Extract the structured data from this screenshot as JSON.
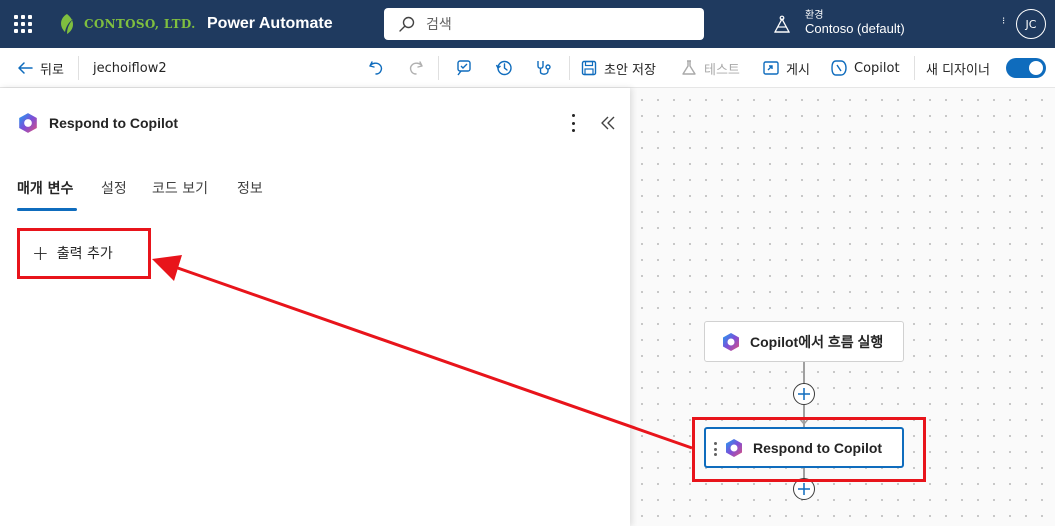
{
  "header": {
    "brand": "CONTOSO, LTD.",
    "app_title": "Power Automate",
    "search_placeholder": "검색",
    "environment_label": "환경",
    "environment_name": "Contoso (default)",
    "user_initials": "JC",
    "background_color": "#1f3a5f"
  },
  "toolbar": {
    "back_label": "뒤로",
    "flow_name": "jechoiflow2",
    "save_draft_label": "초안 저장",
    "test_label": "테스트",
    "publish_label": "게시",
    "copilot_label": "Copilot",
    "new_designer_label": "새 디자이너",
    "new_designer_on": true,
    "accent_color": "#0f6cbd"
  },
  "panel": {
    "title": "Respond to Copilot",
    "tabs": [
      {
        "label": "매개 변수",
        "active": true
      },
      {
        "label": "설정",
        "active": false
      },
      {
        "label": "코드 보기",
        "active": false
      },
      {
        "label": "정보",
        "active": false
      }
    ],
    "add_output_label": "출력 추가"
  },
  "canvas": {
    "nodes": [
      {
        "title": "Copilot에서 흐름 실행",
        "selected": false
      },
      {
        "title": "Respond to Copilot",
        "selected": true
      }
    ]
  },
  "annotation": {
    "color": "#e8141b"
  }
}
